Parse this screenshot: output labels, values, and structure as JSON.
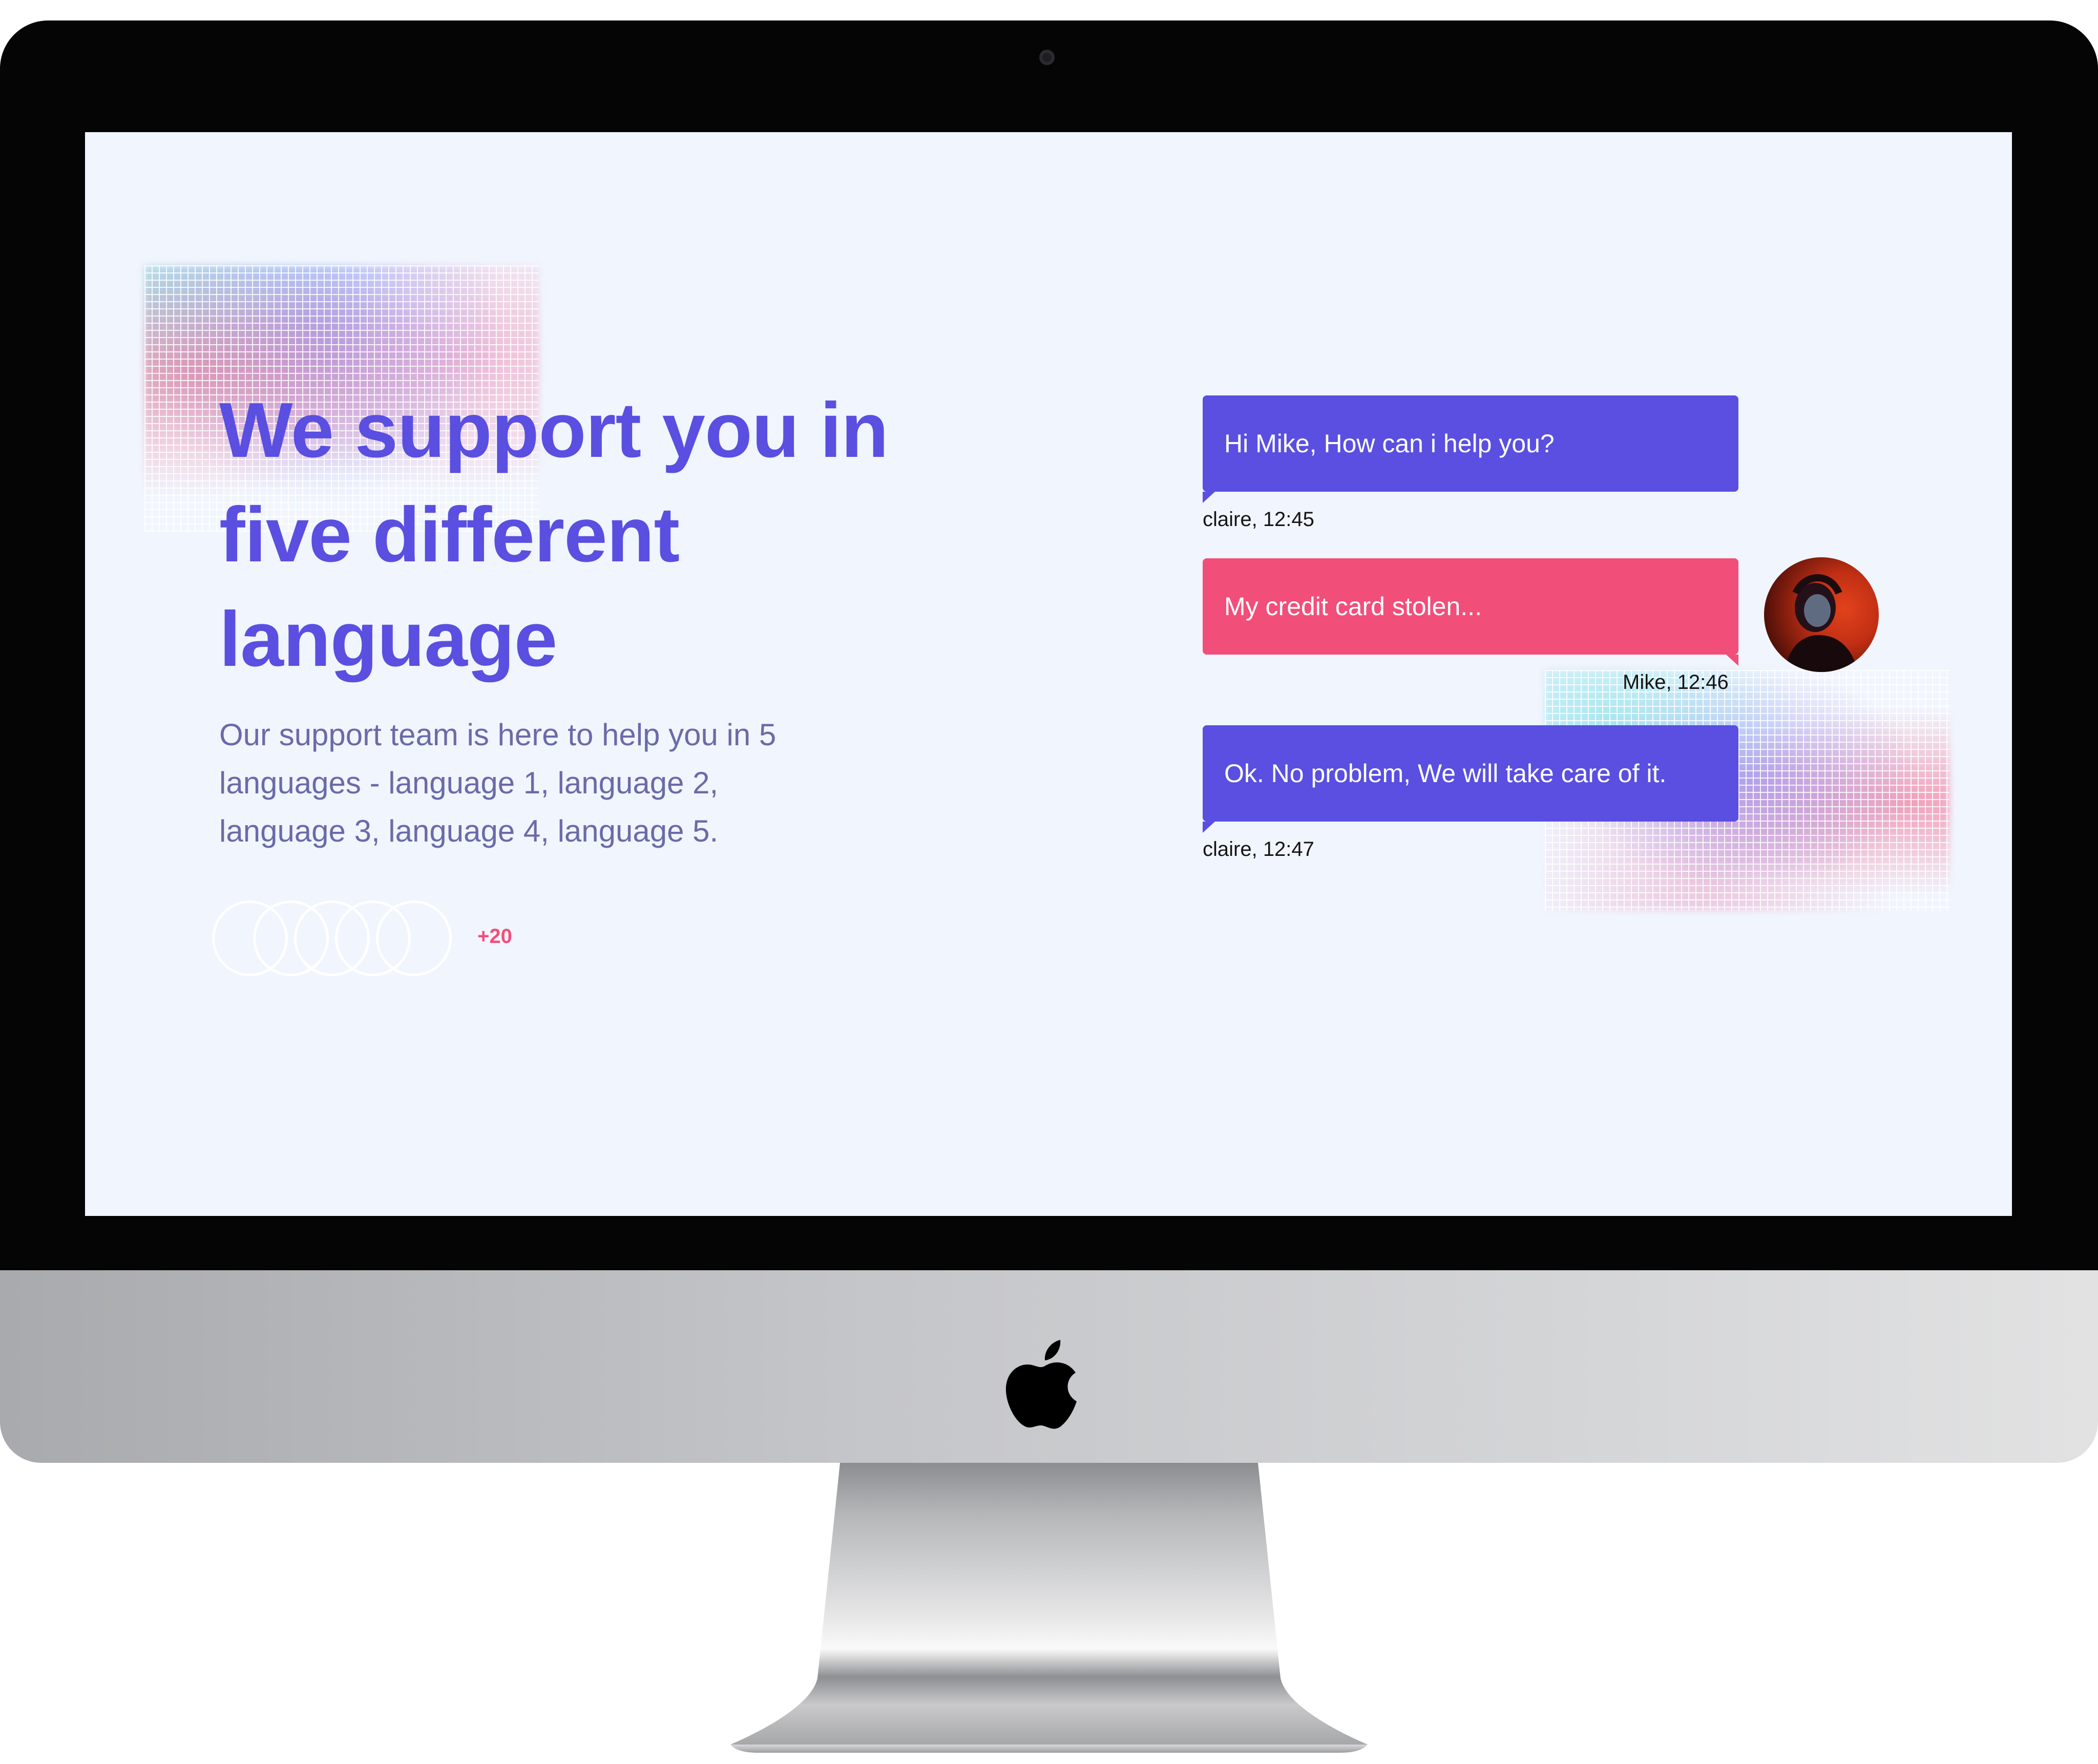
{
  "hero": {
    "title_line1": "We support you in",
    "title_line2": "five different",
    "title_line3": "language",
    "subtitle_line1": "Our support team is here to help you in 5",
    "subtitle_line2": "languages - language 1, language 2,",
    "subtitle_line3": "language 3, language 4, language 5.",
    "more_count": "+20"
  },
  "chat": {
    "messages": [
      {
        "text": "Hi Mike, How can i help you?",
        "meta": "claire, 12:45"
      },
      {
        "text": "My credit card stolen...",
        "meta": "Mike, 12:46"
      },
      {
        "text": "Ok. No problem, We will take care of it.",
        "meta": "claire, 12:47"
      }
    ]
  },
  "colors": {
    "accent": "#5a4fe0",
    "user_bubble": "#f24e7a",
    "screen_bg": "#f1f5fd",
    "subtitle": "#6b6aa8"
  },
  "icons": [
    "apple-logo-icon",
    "camera-icon"
  ]
}
